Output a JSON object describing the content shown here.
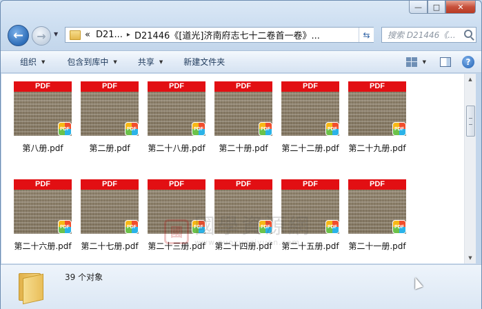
{
  "window": {
    "caption_buttons": {
      "minimize": "—",
      "maximize": "□",
      "close": "✕"
    }
  },
  "address": {
    "segments": [
      "«",
      "D21...",
      "D21446《[道光]济南府志七十二卷首一卷》..."
    ],
    "search_placeholder": "搜索 D21446《..."
  },
  "toolbar": {
    "organize": "组织",
    "include_in_library": "包含到库中",
    "share": "共享",
    "new_folder": "新建文件夹"
  },
  "files": [
    {
      "name": "第八册.pdf",
      "badge": "PDF",
      "banner": "PDF"
    },
    {
      "name": "第二册.pdf",
      "badge": "PDF",
      "banner": "PDF"
    },
    {
      "name": "第二十八册.pdf",
      "badge": "PDF",
      "banner": "PDF"
    },
    {
      "name": "第二十册.pdf",
      "badge": "PDF",
      "banner": "PDF"
    },
    {
      "name": "第二十二册.pdf",
      "badge": "PDF",
      "banner": "PDF"
    },
    {
      "name": "第二十九册.pdf",
      "badge": "PDF",
      "banner": "PDF"
    },
    {
      "name": "第二十六册.pdf",
      "badge": "PDF",
      "banner": "PDF"
    },
    {
      "name": "第二十七册.pdf",
      "badge": "PDF",
      "banner": "PDF"
    },
    {
      "name": "第二十三册.pdf",
      "badge": "PDF",
      "banner": "PDF"
    },
    {
      "name": "第二十四册.pdf",
      "badge": "PDF",
      "banner": "PDF"
    },
    {
      "name": "第二十五册.pdf",
      "badge": "PDF",
      "banner": "PDF"
    },
    {
      "name": "第二十一册.pdf",
      "badge": "PDF",
      "banner": "PDF"
    }
  ],
  "watermark": {
    "title": "國學資源網",
    "url": "www.guoxueziyuan.com",
    "seal": "國"
  },
  "status": {
    "count": "39 个对象"
  },
  "colors": {
    "pdf_red": "#e20f13",
    "accent": "#2d6db8"
  }
}
